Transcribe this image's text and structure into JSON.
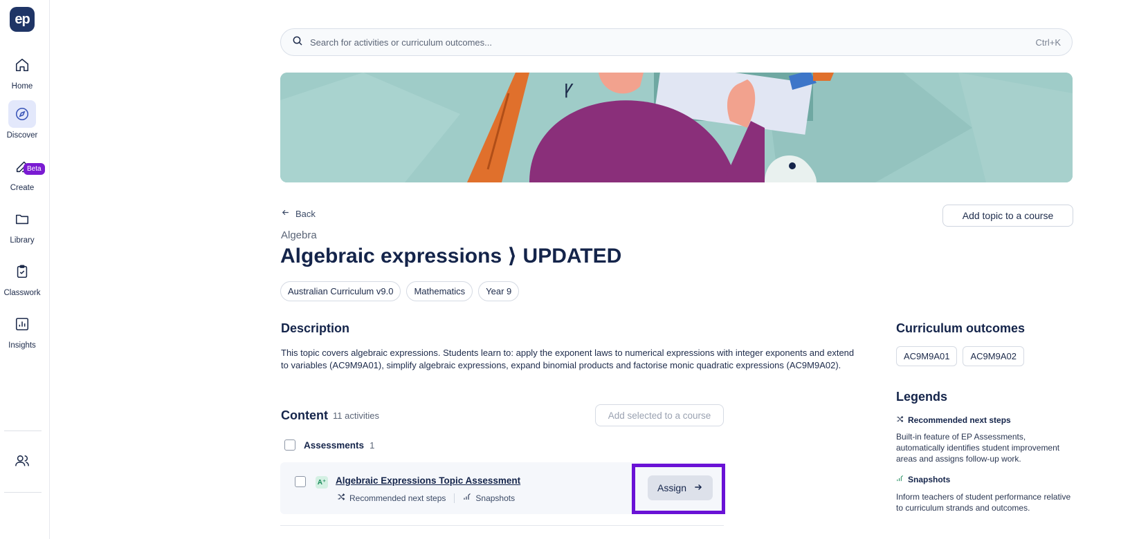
{
  "sidebar": {
    "logo": "ep",
    "items": [
      {
        "label": "Home",
        "icon": "home-icon"
      },
      {
        "label": "Discover",
        "icon": "compass-icon"
      },
      {
        "label": "Create",
        "icon": "edit-icon"
      },
      {
        "label": "Library",
        "icon": "folder-icon"
      },
      {
        "label": "Classwork",
        "icon": "clipboard-icon"
      },
      {
        "label": "Insights",
        "icon": "chart-icon"
      }
    ],
    "beta_badge": "Beta",
    "people_icon": "people-icon"
  },
  "search": {
    "placeholder": "Search for activities or curriculum outcomes...",
    "shortcut": "Ctrl+K"
  },
  "page": {
    "back_label": "Back",
    "add_topic_label": "Add topic to a course",
    "subject": "Algebra",
    "title": "Algebraic expressions ⟩ UPDATED",
    "tags": [
      "Australian Curriculum v9.0",
      "Mathematics",
      "Year 9"
    ],
    "description_heading": "Description",
    "description": "This topic covers algebraic expressions. Students learn to: apply the exponent laws to numerical expressions with integer exponents and extend to variables (AC9M9A01), simplify algebraic expressions, expand binomial products and factorise monic quadratic expressions (AC9M9A02)."
  },
  "content": {
    "heading": "Content",
    "count": "11 activities",
    "add_selected_label": "Add selected to a course",
    "assessments_label": "Assessments",
    "assessments_count": "1",
    "item": {
      "badge": "A⁺",
      "title": "Algebraic Expressions Topic Assessment",
      "meta_1": "Recommended next steps",
      "meta_2": "Snapshots",
      "assign_label": "Assign"
    }
  },
  "right": {
    "outcomes_heading": "Curriculum outcomes",
    "outcomes": [
      "AC9M9A01",
      "AC9M9A02"
    ],
    "legends_heading": "Legends",
    "legend_1_title": "Recommended next steps",
    "legend_1_desc": "Built-in feature of EP Assessments, automatically identifies student improvement areas and assigns follow-up work.",
    "legend_2_title": "Snapshots",
    "legend_2_desc": "Inform teachers of student performance relative to curriculum strands and outcomes."
  },
  "colors": {
    "brand": "#1f3566",
    "highlight": "#6a12d6",
    "beta": "#7a1bd2",
    "banner_bg": "#9fccc8"
  }
}
